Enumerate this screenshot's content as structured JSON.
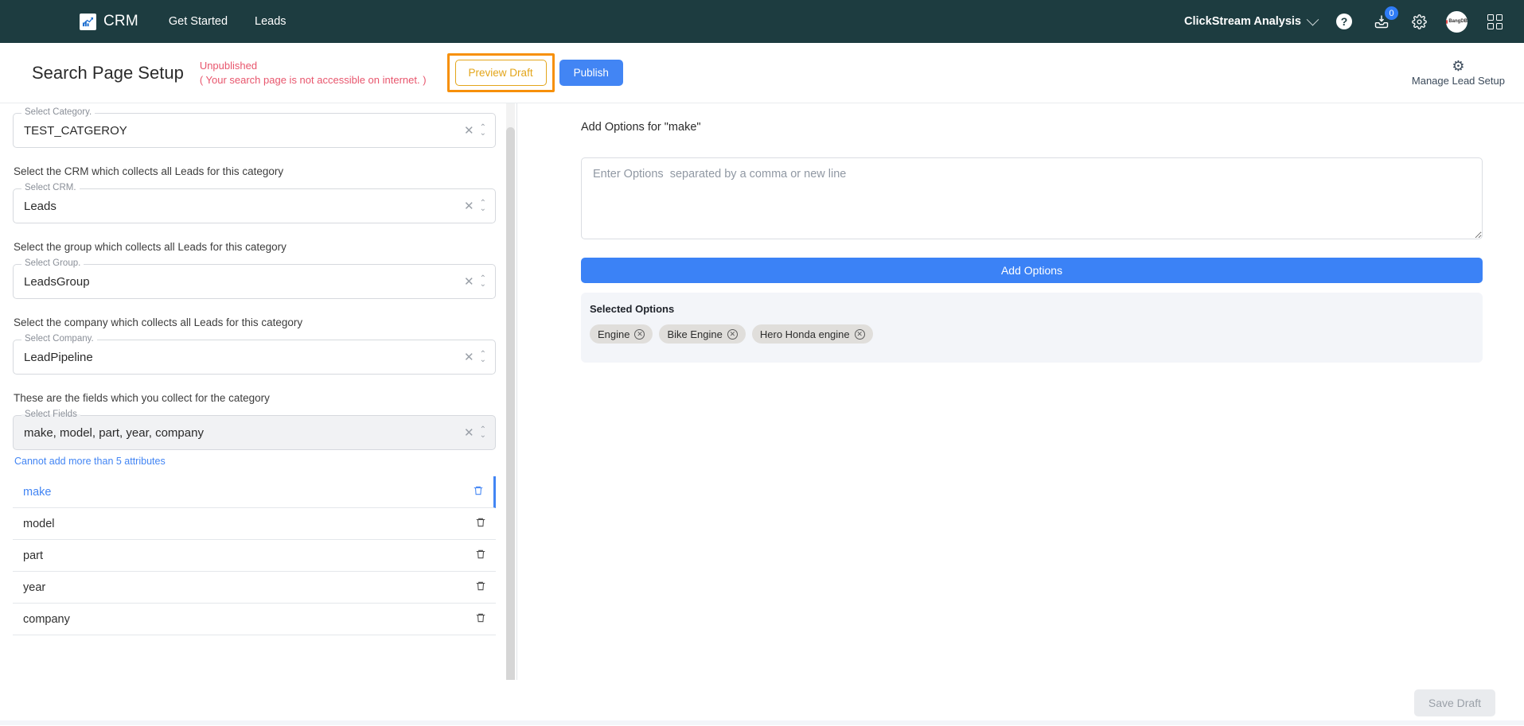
{
  "topnav": {
    "brand": "CRM",
    "logo_icon": "chart-arrow-icon",
    "links": [
      {
        "label": "Get Started"
      },
      {
        "label": "Leads"
      }
    ],
    "workspace": "ClickStream Analysis",
    "workspace_caret_icon": "chevron-down-icon",
    "help_icon": "question-mark-icon",
    "help_glyph": "?",
    "inbox_icon": "inbox-download-icon",
    "inbox_badge": "0",
    "settings_icon": "gear-icon",
    "settings_glyph": "⚙",
    "avatar_label": "BangDB",
    "apps_icon": "apps-grid-icon",
    "accent_badge_color": "#2f7cf6",
    "bar_color": "#1d3c40"
  },
  "page_header": {
    "title": "Search Page Setup",
    "status_main": "Unpublished",
    "status_sub": "( Your search page is not accessible on internet. )",
    "status_color": "#e8566d",
    "preview_button": "Preview Draft",
    "preview_highlight_color": "#f79009",
    "publish_button": "Publish",
    "publish_color": "#4285f4",
    "manage_setup_icon": "gear-icon",
    "manage_setup_glyph": "⚙",
    "manage_setup_label": "Manage Lead Setup"
  },
  "left_panel": {
    "category_field": {
      "label": "Select Category.",
      "value": "TEST_CATGEROY",
      "clear_glyph": "✕",
      "caret_glyph": "⌃",
      "caret_glyph_down": "⌄"
    },
    "crm_helper": "Select the CRM which collects all Leads for this category",
    "crm_field": {
      "label": "Select CRM.",
      "value": "Leads"
    },
    "group_helper": "Select the group which collects all Leads for this category",
    "group_field": {
      "label": "Select Group.",
      "value": "LeadsGroup"
    },
    "company_helper": "Select the company which collects all Leads for this category",
    "company_field": {
      "label": "Select Company.",
      "value": "LeadPipeline"
    },
    "fields_helper": "These are the fields which you collect for the category",
    "fields_field": {
      "label": "Select Fields",
      "value": "make, model, part, year, company"
    },
    "fields_note": "Cannot add more than 5 attributes",
    "fields_note_color": "#4285f4",
    "attributes": [
      {
        "name": "make",
        "selected": true,
        "delete_icon": "trash-icon",
        "delete_glyph": "🗑"
      },
      {
        "name": "model",
        "selected": false,
        "delete_icon": "trash-icon",
        "delete_glyph": "🗑"
      },
      {
        "name": "part",
        "selected": false,
        "delete_icon": "trash-icon",
        "delete_glyph": "🗑"
      },
      {
        "name": "year",
        "selected": false,
        "delete_icon": "trash-icon",
        "delete_glyph": "🗑"
      },
      {
        "name": "company",
        "selected": false,
        "delete_icon": "trash-icon",
        "delete_glyph": "🗑"
      }
    ],
    "selected_accent": "#4285f4"
  },
  "right_panel": {
    "title": "Add Options for \"make\"",
    "textarea_value": "",
    "textarea_placeholder": "Enter Options  separated by a comma or new line",
    "add_options_button": "Add Options",
    "add_options_color": "#3b82f6",
    "selected_options_title": "Selected Options",
    "selected_options": [
      {
        "label": "Engine",
        "remove_icon": "remove-circle-icon",
        "remove_glyph": "✕"
      },
      {
        "label": "Bike Engine",
        "remove_icon": "remove-circle-icon",
        "remove_glyph": "✕"
      },
      {
        "label": "Hero Honda engine",
        "remove_icon": "remove-circle-icon",
        "remove_glyph": "✕"
      }
    ]
  },
  "footer": {
    "save_draft_button": "Save Draft"
  }
}
